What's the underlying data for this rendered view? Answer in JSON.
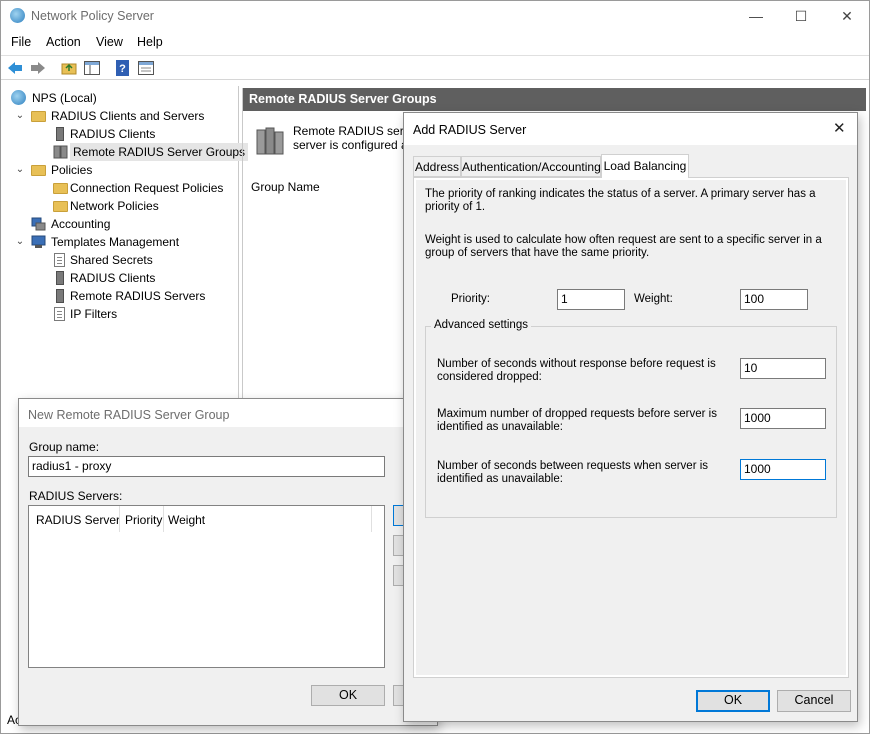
{
  "window": {
    "title": "Network Policy Server",
    "minimize": "—",
    "maximize": "☐",
    "close": "✕"
  },
  "menu": [
    "File",
    "Action",
    "View",
    "Help"
  ],
  "tree": {
    "root": "NPS (Local)",
    "radius_clients_servers": "RADIUS Clients and Servers",
    "radius_clients": "RADIUS Clients",
    "remote_groups": "Remote RADIUS Server Groups",
    "policies": "Policies",
    "connection_request_policies": "Connection Request Policies",
    "network_policies": "Network Policies",
    "accounting": "Accounting",
    "templates_management": "Templates Management",
    "shared_secrets": "Shared Secrets",
    "tmpl_radius_clients": "RADIUS Clients",
    "remote_radius_servers": "Remote RADIUS Servers",
    "ip_filters": "IP Filters"
  },
  "right_pane": {
    "header": "Remote RADIUS Server Groups",
    "desc_line1": "Remote RADIUS server",
    "desc_line2": "server is configured as a",
    "column_group_name": "Group Name"
  },
  "group_dialog": {
    "title": "New Remote RADIUS Server Group",
    "group_name_label": "Group name:",
    "group_name_value": "radius1 - proxy",
    "servers_label": "RADIUS Servers:",
    "columns": [
      "RADIUS Server",
      "Priority",
      "Weight"
    ],
    "ok": "OK",
    "status_fragment": "Ac"
  },
  "add_dialog": {
    "title": "Add RADIUS Server",
    "close": "✕",
    "tabs": [
      "Address",
      "Authentication/Accounting",
      "Load Balancing"
    ],
    "active_tab": "Load Balancing",
    "priority_text": "The priority of ranking indicates the status of a server. A primary server has a priority of 1.",
    "weight_text": "Weight is used to calculate how often request are sent to a specific server in a group of servers that have the same priority.",
    "priority_label": "Priority:",
    "priority_value": "1",
    "weight_label": "Weight:",
    "weight_value": "100",
    "advanced_label": "Advanced settings",
    "seconds_label": "Number of seconds without response before request is considered dropped:",
    "seconds_value": "10",
    "max_dropped_label": "Maximum number of dropped requests before server is identified as unavailable:",
    "max_dropped_value": "1000",
    "between_label": "Number of seconds between requests when server is identified as unavailable:",
    "between_value": "1000",
    "ok": "OK",
    "cancel": "Cancel"
  }
}
